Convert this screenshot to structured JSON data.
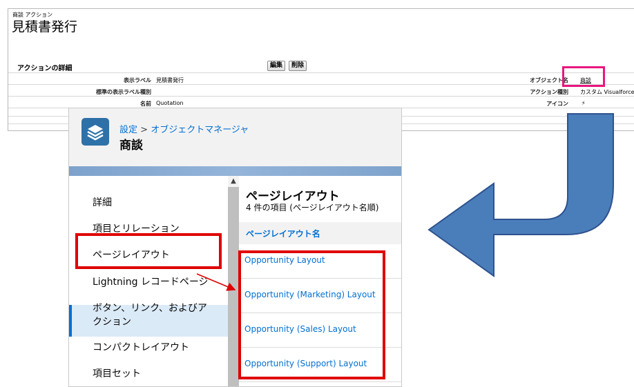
{
  "classic": {
    "breadcrumb": "商談 アクション",
    "title": "見積書発行",
    "section_title": "アクションの詳細",
    "buttons": {
      "edit": "編集",
      "delete": "削除"
    },
    "fields_left": [
      {
        "label": "表示ラベル",
        "value": "見積書発行"
      },
      {
        "label": "標準の表示ラベル種別",
        "value": ""
      },
      {
        "label": "名前",
        "value": "Quotation"
      }
    ],
    "fields_right": [
      {
        "label": "オブジェクト名",
        "value": "商談"
      },
      {
        "label": "アクション種別",
        "value": "カスタム Visualforce"
      },
      {
        "label": "アイコン",
        "value": "⚡"
      }
    ]
  },
  "lightning": {
    "breadcrumb_setup": "設定",
    "breadcrumb_sep": " > ",
    "breadcrumb_object_manager": "オブジェクトマネージャ",
    "object_title": "商談",
    "icon": "layers-icon",
    "sidebar": {
      "items": [
        {
          "label": "詳細"
        },
        {
          "label": "項目とリレーション"
        },
        {
          "label": "ページレイアウト",
          "active": true
        },
        {
          "label": "Lightning レコードページ"
        },
        {
          "label": "ボタン、リンク、およびア"
        },
        {
          "label": "クション"
        },
        {
          "label": "コンパクトレイアウト"
        },
        {
          "label": "項目セット"
        }
      ]
    },
    "content": {
      "title": "ページレイアウト",
      "subtitle": "4 件の項目 (ページレイアウト名順)",
      "column_header": "ページレイアウト名",
      "rows": [
        "Opportunity Layout",
        "Opportunity (Marketing) Layout",
        "Opportunity (Sales) Layout",
        "Opportunity (Support) Layout"
      ]
    }
  },
  "colors": {
    "highlight_pink": "#e8177f",
    "highlight_red": "#e00000",
    "arrow_fill": "#4a7ebb",
    "arrow_stroke": "#2f528f",
    "link_blue": "#0070d2"
  }
}
